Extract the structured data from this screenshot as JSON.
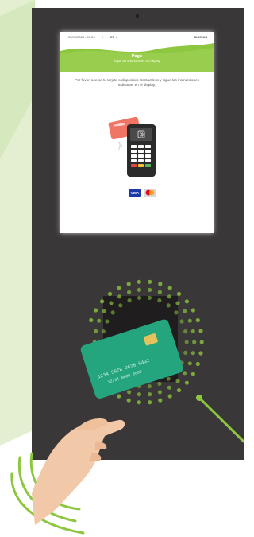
{
  "screen": {
    "status_bar": {
      "datetime": "25/06/2024 - 09:59",
      "info_icon": "i",
      "language": "ES",
      "logo": "DIGINUS"
    },
    "header": {
      "title": "Pago",
      "subtitle": "Sigue las instrucciones del display"
    },
    "instruction": "Por favor, acerca tu tarjeta o dispositivo Contactless y sigue las instrucciones indicadas en el display.",
    "payment_methods": [
      "VISA",
      "Mastercard"
    ]
  },
  "card": {
    "number_line": "1234  5678  9876  5432",
    "expiry_line": "12/34  0000  0000"
  },
  "colors": {
    "accent": "#8dc63f",
    "kiosk": "#3a3738",
    "terminal": "#2b2b2b",
    "card": "#1f9e77",
    "light_green": "#e3efd0"
  }
}
